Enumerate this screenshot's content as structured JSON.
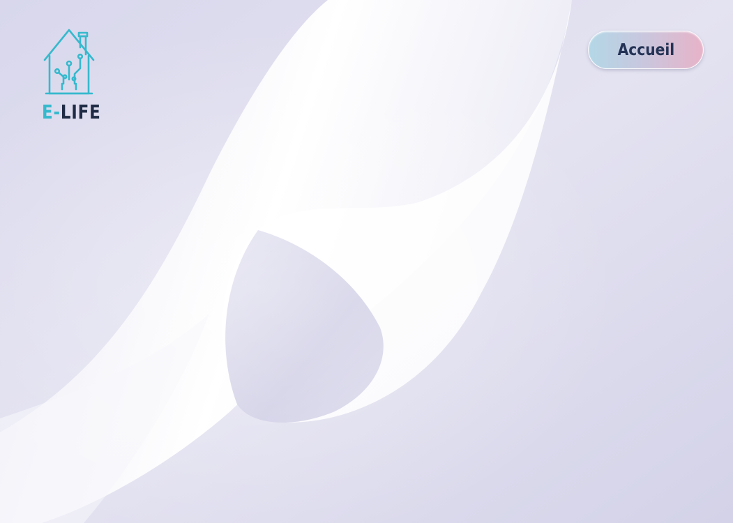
{
  "brand": {
    "logo_icon": "smart-house-icon",
    "name_prefix": "E-",
    "name_suffix": "LIFE",
    "accent_color": "#36b9cd",
    "text_color": "#1f2b44"
  },
  "nav": {
    "home_label": "Accueil"
  },
  "theme": {
    "background_color": "#d6d5ea",
    "button_gradient": [
      "#b3d7e6",
      "#e7b3c8"
    ]
  }
}
